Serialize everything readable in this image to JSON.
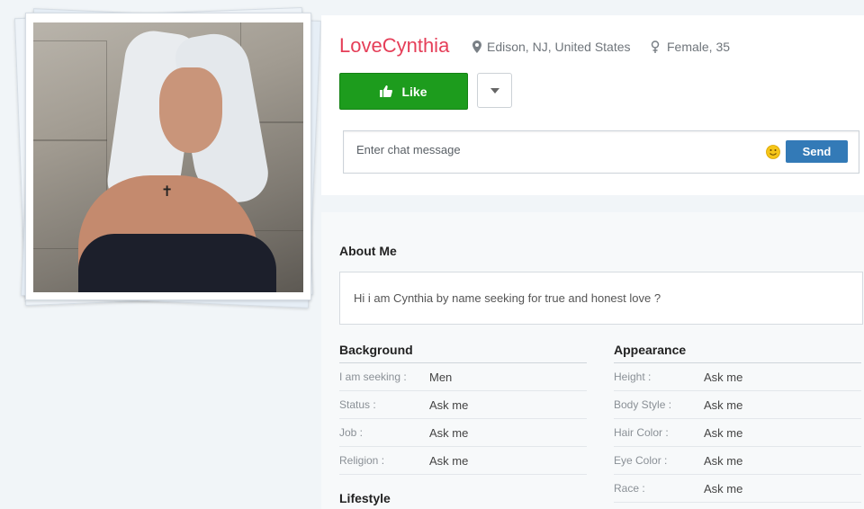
{
  "profile": {
    "username": "LoveCynthia",
    "location": "Edison, NJ, United States",
    "gender_age": "Female, 35"
  },
  "actions": {
    "like_label": "Like"
  },
  "chat": {
    "placeholder": "Enter chat message",
    "send_label": "Send"
  },
  "about": {
    "title": "About Me",
    "text": "Hi i am Cynthia by name seeking for true and honest love ?"
  },
  "background": {
    "title": "Background",
    "rows": [
      {
        "label": "I am seeking :",
        "value": "Men"
      },
      {
        "label": "Status :",
        "value": "Ask me"
      },
      {
        "label": "Job :",
        "value": "Ask me"
      },
      {
        "label": "Religion :",
        "value": "Ask me"
      }
    ]
  },
  "appearance": {
    "title": "Appearance",
    "rows": [
      {
        "label": "Height :",
        "value": "Ask me"
      },
      {
        "label": "Body Style :",
        "value": "Ask me"
      },
      {
        "label": "Hair Color :",
        "value": "Ask me"
      },
      {
        "label": "Eye Color :",
        "value": "Ask me"
      },
      {
        "label": "Race :",
        "value": "Ask me"
      }
    ]
  },
  "lifestyle": {
    "title": "Lifestyle"
  },
  "icons": {
    "location": "map-marker-icon",
    "gender": "female-icon",
    "like": "thumbs-up-icon",
    "dropdown": "caret-down-icon",
    "emoji": "smiley-icon"
  },
  "colors": {
    "username": "#e53e58",
    "like_button": "#1d9c1d",
    "send_button": "#337ab7"
  }
}
